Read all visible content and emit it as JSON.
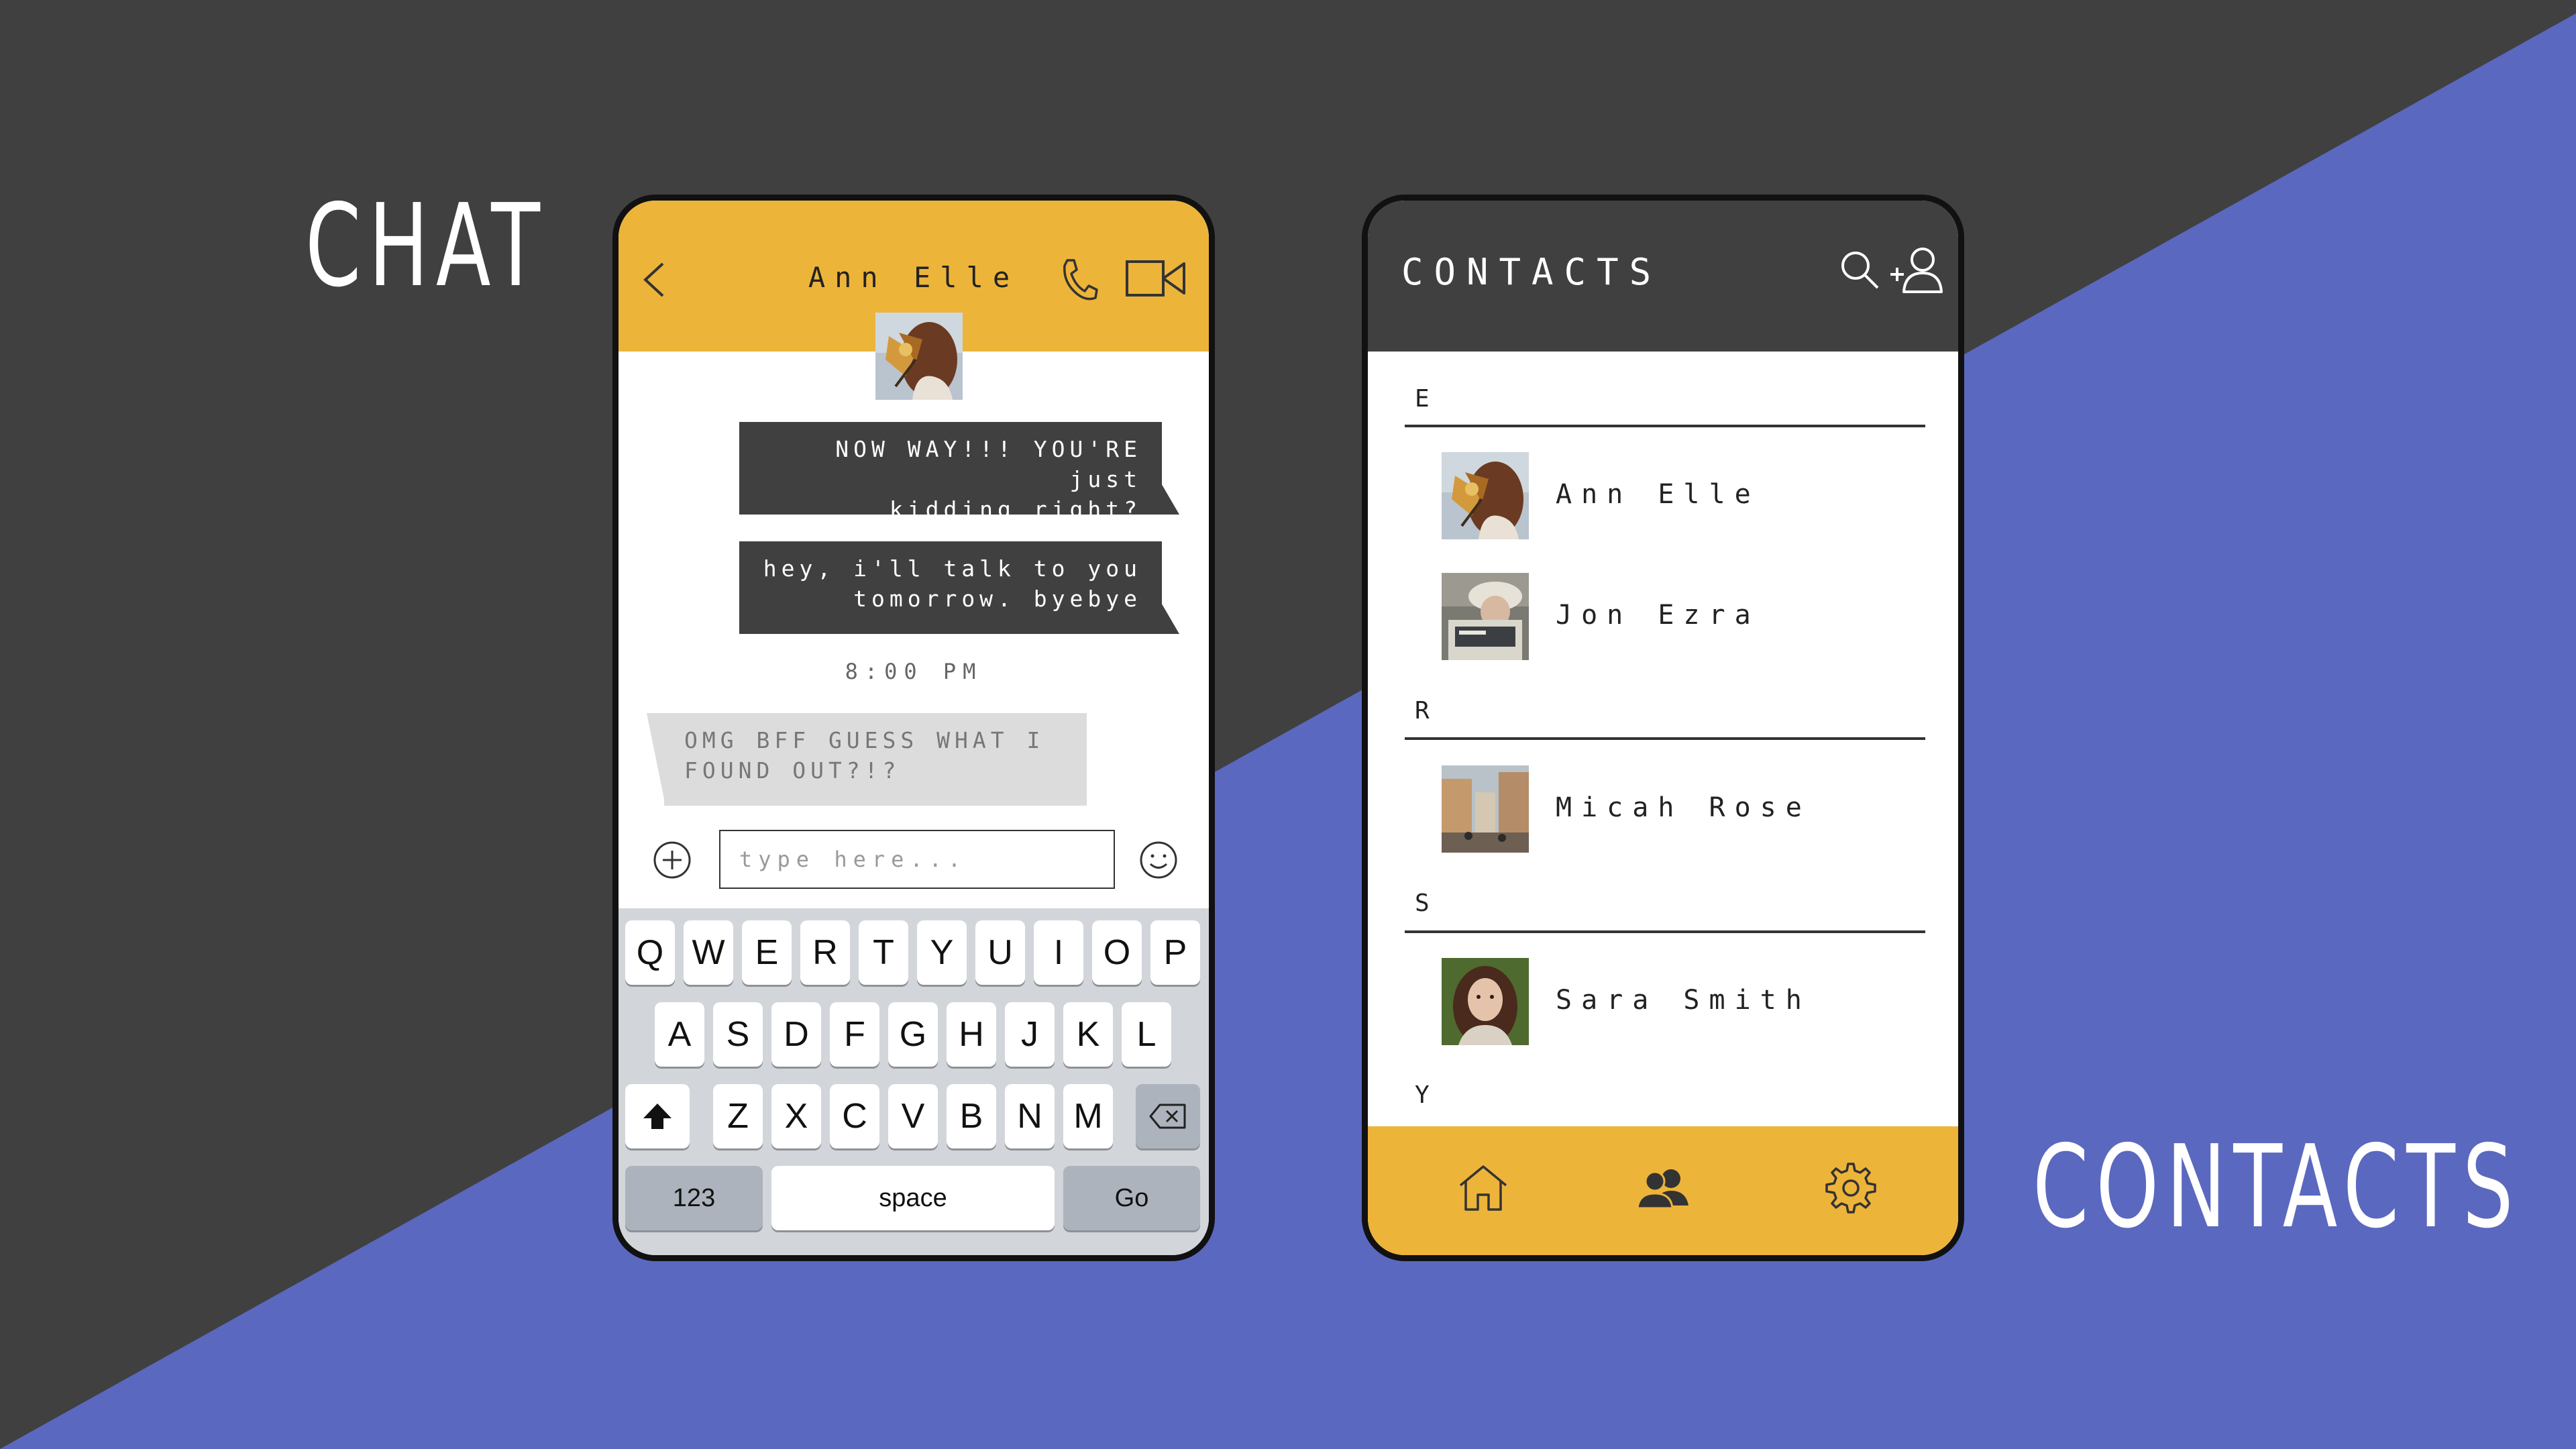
{
  "colors": {
    "background_dark": "#404040",
    "background_accent": "#5b68bf",
    "header_yellow": "#edb43a",
    "bubble_dark": "#404040",
    "bubble_light": "#dcdcdc"
  },
  "labels": {
    "chat": "CHAT",
    "contacts": "CONTACTS"
  },
  "chat": {
    "header": {
      "contact_name": "Ann Elle",
      "icons": [
        "back-icon",
        "phone-icon",
        "video-icon"
      ]
    },
    "messages": [
      {
        "direction": "outgoing",
        "text": "NOW WAY!!! YOU'RE just kidding right?",
        "line1": "NOW WAY!!! YOU'RE just",
        "line2": "kidding right?"
      },
      {
        "direction": "outgoing",
        "text": "hey, i'll talk to you tomorrow. byebye",
        "line1": "hey, i'll talk to you",
        "line2": "tomorrow. byebye"
      },
      {
        "direction": "incoming",
        "text": "OMG BFF GUESS WHAT I FOUND OUT?!?",
        "line1": "OMG BFF GUESS WHAT I",
        "line2": "FOUND OUT?!?"
      }
    ],
    "timestamp": "8:00 PM",
    "input": {
      "placeholder": "type here...",
      "value": ""
    },
    "keyboard": {
      "row1": [
        "Q",
        "W",
        "E",
        "R",
        "T",
        "Y",
        "U",
        "I",
        "O",
        "P"
      ],
      "row2": [
        "A",
        "S",
        "D",
        "F",
        "G",
        "H",
        "J",
        "K",
        "L"
      ],
      "row3": [
        "Z",
        "X",
        "C",
        "V",
        "B",
        "N",
        "M"
      ],
      "numbers_key": "123",
      "space_key": "space",
      "go_key": "Go"
    }
  },
  "contacts": {
    "title": "CONTACTS",
    "header_icons": [
      "search-icon",
      "add-user-icon"
    ],
    "sections": [
      {
        "letter": "E",
        "contacts": [
          "Ann Elle",
          "Jon Ezra"
        ]
      },
      {
        "letter": "R",
        "contacts": [
          "Micah Rose"
        ]
      },
      {
        "letter": "S",
        "contacts": [
          "Sara Smith"
        ]
      },
      {
        "letter": "Y",
        "contacts": []
      }
    ],
    "nav": [
      "home-icon",
      "contacts-icon",
      "settings-icon"
    ]
  }
}
